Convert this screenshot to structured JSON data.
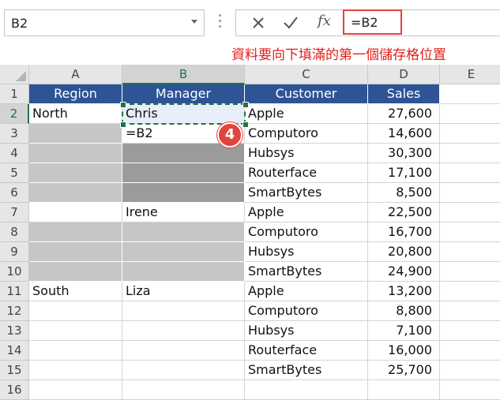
{
  "name_box": {
    "value": "B2"
  },
  "formula_bar": {
    "cancel_icon": "close-icon",
    "enter_icon": "check-icon",
    "fx_label": "fx",
    "value": "=B2"
  },
  "annotation": "資料要向下填滿的第一個儲存格位置",
  "step_badge": "4",
  "columns": [
    "A",
    "B",
    "C",
    "D",
    "E"
  ],
  "rows": [
    "1",
    "2",
    "3",
    "4",
    "5",
    "6",
    "7",
    "8",
    "9",
    "10",
    "11",
    "12",
    "13",
    "14",
    "15",
    "16"
  ],
  "headers": {
    "region": "Region",
    "manager": "Manager",
    "customer": "Customer",
    "sales": "Sales"
  },
  "cells": {
    "A2": "North",
    "B2": "Chris",
    "B3": "=B2",
    "B7": "Irene",
    "A11": "South",
    "B11": "Liza",
    "C2": "Apple",
    "D2": "27,600",
    "C3": "Computoro",
    "D3": "14,600",
    "C4": "Hubsys",
    "D4": "30,300",
    "C5": "Routerface",
    "D5": "17,100",
    "C6": "SmartBytes",
    "D6": "8,500",
    "C7": "Apple",
    "D7": "22,500",
    "C8": "Computoro",
    "D8": "16,700",
    "C9": "Hubsys",
    "D9": "20,800",
    "C10": "SmartBytes",
    "D10": "24,900",
    "C11": "Apple",
    "D11": "13,200",
    "C12": "Computoro",
    "D12": "8,800",
    "C13": "Hubsys",
    "D13": "7,100",
    "C14": "Routerface",
    "D14": "16,000",
    "C15": "SmartBytes",
    "D15": "25,700"
  },
  "colors": {
    "header_fill": "#2e5496",
    "annotation": "#e0201a",
    "selection": "#217346",
    "blank_light": "#c6c6c6",
    "blank_dark": "#9b9b9b"
  }
}
